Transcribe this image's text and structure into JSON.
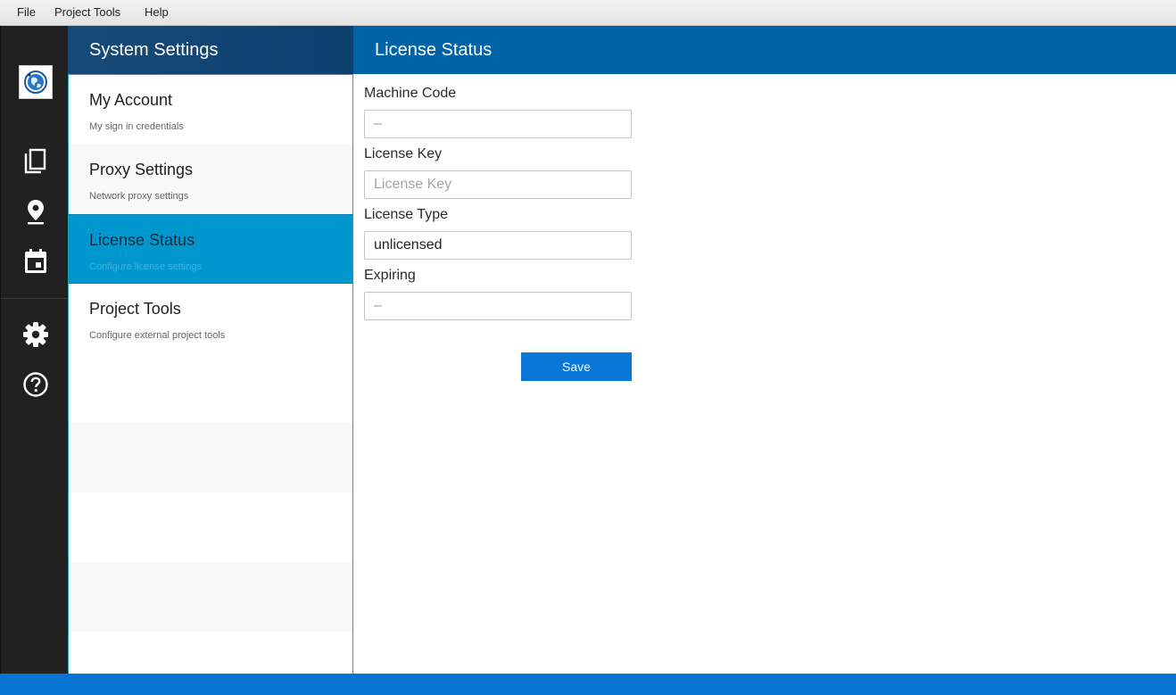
{
  "menubar": {
    "items": [
      {
        "label": "File"
      },
      {
        "label": "Project Tools"
      },
      {
        "label": "Help"
      }
    ]
  },
  "rail": {
    "icons": [
      "globe-logo-icon",
      "copy-icon",
      "location-pin-icon",
      "calendar-icon",
      "gear-icon",
      "help-circle-icon"
    ]
  },
  "settings": {
    "title": "System Settings",
    "items": [
      {
        "title": "My Account",
        "subtitle": "My sign in credentials"
      },
      {
        "title": "Proxy Settings",
        "subtitle": "Network proxy settings"
      },
      {
        "title": "License Status",
        "subtitle": "Configure license settings",
        "active": true
      },
      {
        "title": "Project Tools",
        "subtitle": "Configure external project tools"
      }
    ]
  },
  "main": {
    "title": "License Status",
    "fields": {
      "machine_code": {
        "label": "Machine Code",
        "value": "–"
      },
      "license_key": {
        "label": "License Key",
        "value": "",
        "placeholder": "License Key"
      },
      "license_type": {
        "label": "License Type",
        "value": "unlicensed"
      },
      "expiring": {
        "label": "Expiring",
        "value": "–"
      }
    },
    "save_label": "Save"
  },
  "colors": {
    "accent": "#0097cf",
    "header_main": "#0063a8",
    "header_settings": "#184a78",
    "rail": "#212121",
    "button": "#0a77d8"
  }
}
